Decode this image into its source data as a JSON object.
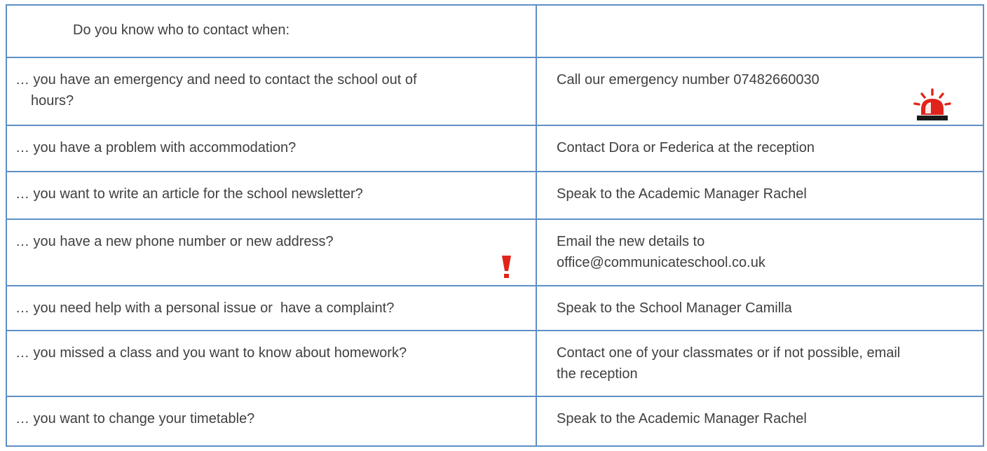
{
  "table": {
    "header": {
      "question": "Do you know who to contact when:",
      "answer": ""
    },
    "rows": [
      {
        "question_line1": "… you have an emergency and need to contact the school out of",
        "question_line2": "hours?",
        "answer_line1": "Call our emergency number 07482660030",
        "icon": "siren-icon"
      },
      {
        "question": "… you have a problem with accommodation?",
        "answer": "Contact Dora or Federica at the reception"
      },
      {
        "question": "… you want to write an article for the school newsletter?",
        "answer": "Speak to the Academic Manager Rachel"
      },
      {
        "question": "… you have a new phone number or new address?",
        "answer_line1": "Email the new details to",
        "answer_line2": "office@communicateschool.co.uk",
        "icon": "exclamation-icon"
      },
      {
        "question": "… you need help with a personal issue or  have a complaint?",
        "answer": "Speak to the School Manager Camilla"
      },
      {
        "question": "… you missed a class and you want to know about homework?",
        "answer_line1": "Contact one of your classmates or if not possible, email",
        "answer_line2": "the reception"
      },
      {
        "question": "… you want to change your timetable?",
        "answer": "Speak to the Academic Manager Rachel"
      }
    ]
  },
  "colors": {
    "border": "#5f8fc6",
    "text": "#3f3f3f",
    "siren_red": "#e0241b",
    "siren_base": "#1a1a1a"
  }
}
